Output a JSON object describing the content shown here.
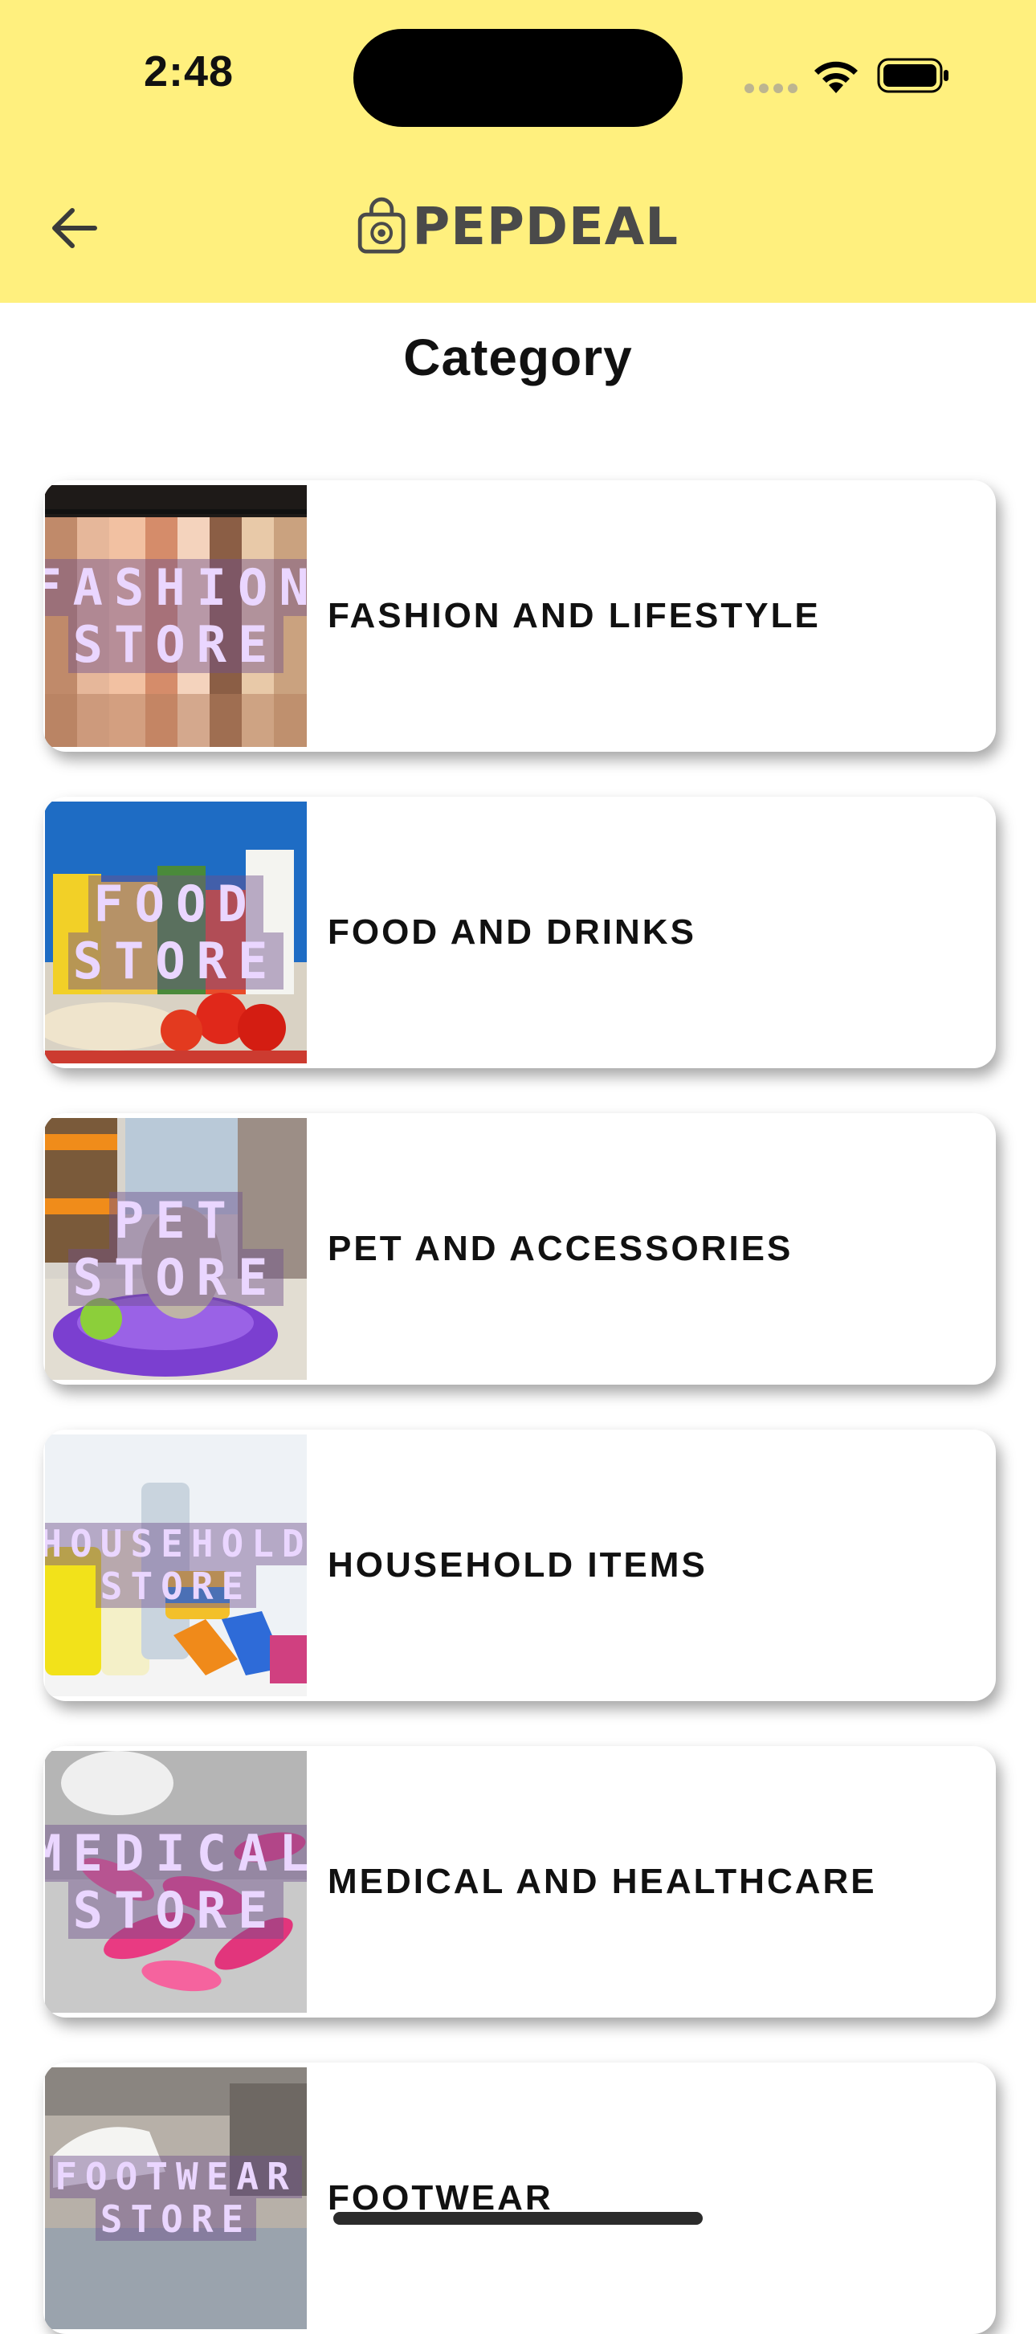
{
  "status_bar": {
    "time": "2:48"
  },
  "header": {
    "brand": "PEPDEAL",
    "background": "#FFF07E"
  },
  "page": {
    "title": "Category"
  },
  "categories": [
    {
      "title": "FASHION AND LIFESTYLE",
      "thumb_lines": [
        "FASHION",
        "STORE"
      ],
      "thumb_icon": "clothes-rack-photo"
    },
    {
      "title": "FOOD AND DRINKS",
      "thumb_lines": [
        "FOOD",
        "STORE"
      ],
      "thumb_icon": "groceries-photo"
    },
    {
      "title": "PET AND ACCESSORIES",
      "thumb_lines": [
        "PET",
        "STORE"
      ],
      "thumb_icon": "dog-in-pet-bed-photo"
    },
    {
      "title": "HOUSEHOLD ITEMS",
      "thumb_lines": [
        "HOUSEHOLD",
        "STORE"
      ],
      "thumb_icon": "cleaning-supplies-photo"
    },
    {
      "title": "MEDICAL AND HEALTHCARE",
      "thumb_lines": [
        "MEDICAL",
        "STORE"
      ],
      "thumb_icon": "pink-pills-photo"
    },
    {
      "title": "FOOTWEAR",
      "thumb_lines": [
        "FOOTWEAR",
        "STORE"
      ],
      "thumb_icon": "shoes-photo"
    }
  ]
}
